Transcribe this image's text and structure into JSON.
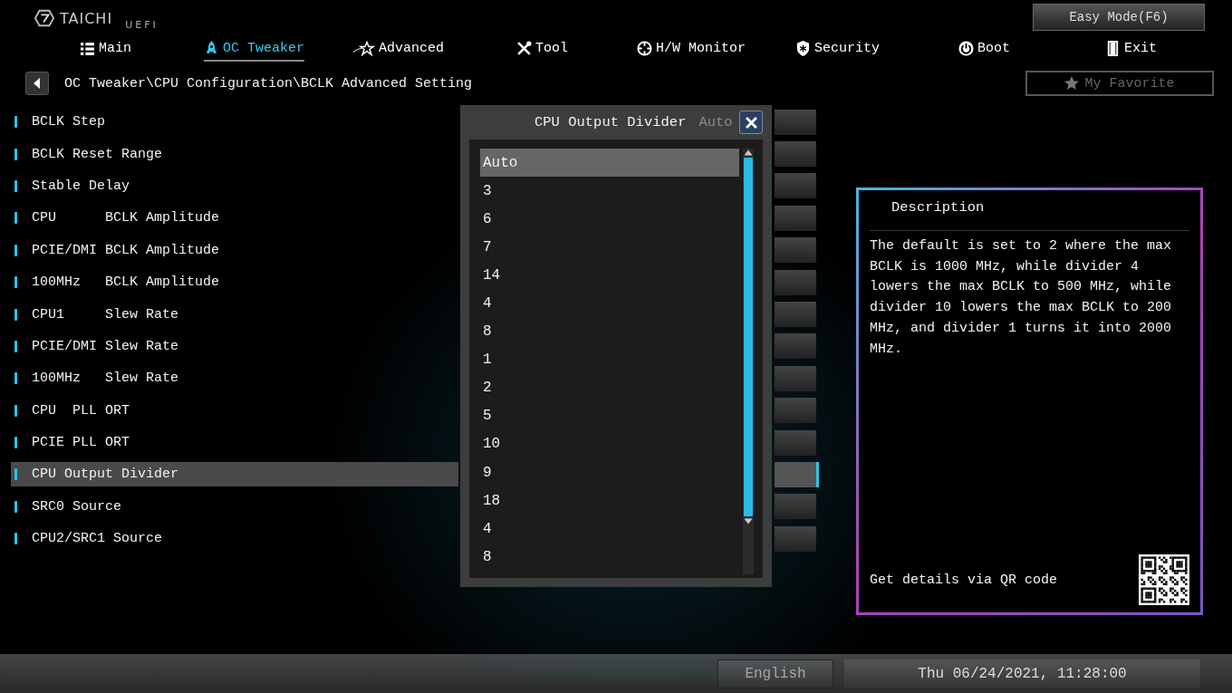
{
  "header": {
    "logo": "TAICHI",
    "logo_sub": "UEFI",
    "easy_mode": "Easy Mode(F6)",
    "exit": "Exit",
    "favorite": "My Favorite"
  },
  "tabs": [
    {
      "label": "Main",
      "kind": "list",
      "selected": false
    },
    {
      "label": "OC Tweaker",
      "kind": "rocket",
      "selected": true
    },
    {
      "label": "Advanced",
      "kind": "star",
      "selected": false
    },
    {
      "label": "Tool",
      "kind": "tools",
      "selected": false
    },
    {
      "label": "H/W Monitor",
      "kind": "crosshair",
      "selected": false
    },
    {
      "label": "Security",
      "kind": "shield",
      "selected": false
    },
    {
      "label": "Boot",
      "kind": "power",
      "selected": false
    }
  ],
  "breadcrumb": "OC Tweaker\\CPU Configuration\\BCLK Advanced Setting",
  "settings": [
    {
      "label": "BCLK Step",
      "selected": false
    },
    {
      "label": "BCLK Reset Range",
      "selected": false
    },
    {
      "label": "Stable Delay",
      "selected": false
    },
    {
      "label": "CPU      BCLK Amplitude",
      "selected": false
    },
    {
      "label": "PCIE/DMI BCLK Amplitude",
      "selected": false
    },
    {
      "label": "100MHz   BCLK Amplitude",
      "selected": false
    },
    {
      "label": "CPU1     Slew Rate",
      "selected": false
    },
    {
      "label": "PCIE/DMI Slew Rate",
      "selected": false
    },
    {
      "label": "100MHz   Slew Rate",
      "selected": false
    },
    {
      "label": "CPU  PLL ORT",
      "selected": false
    },
    {
      "label": "PCIE PLL ORT",
      "selected": false
    },
    {
      "label": "CPU Output Divider",
      "selected": true
    },
    {
      "label": "SRC0 Source",
      "selected": false
    },
    {
      "label": "CPU2/SRC1 Source",
      "selected": false
    }
  ],
  "modal": {
    "title": "CPU Output Divider",
    "background_value": "Auto",
    "options": [
      {
        "label": "Auto",
        "selected": true
      },
      {
        "label": "3",
        "selected": false
      },
      {
        "label": "6",
        "selected": false
      },
      {
        "label": "7",
        "selected": false
      },
      {
        "label": "14",
        "selected": false
      },
      {
        "label": "4",
        "selected": false
      },
      {
        "label": "8",
        "selected": false
      },
      {
        "label": "1",
        "selected": false
      },
      {
        "label": "2",
        "selected": false
      },
      {
        "label": "5",
        "selected": false
      },
      {
        "label": "10",
        "selected": false
      },
      {
        "label": "9",
        "selected": false
      },
      {
        "label": "18",
        "selected": false
      },
      {
        "label": "4",
        "selected": false
      },
      {
        "label": "8",
        "selected": false
      }
    ]
  },
  "description": {
    "title": "Description",
    "text": "The default is set to 2 where the max BCLK is 1000 MHz, while divider 4 lowers the max BCLK to 500 MHz, while divider 10 lowers the max BCLK to 200 MHz, and divider 1 turns it into 2000 MHz.",
    "qr_label": "Get details via QR code"
  },
  "status_bar": {
    "language": "English",
    "datetime": "Thu 06/24/2021, 11:28:00"
  }
}
